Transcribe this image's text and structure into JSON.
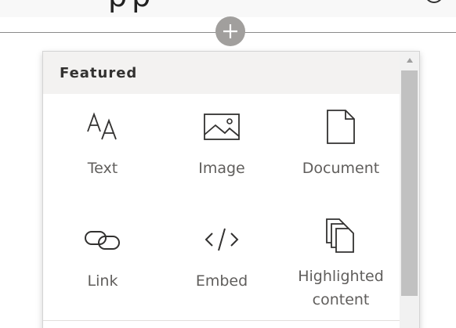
{
  "toolbox": {
    "section_title": "Featured",
    "items": [
      {
        "label": "Text",
        "icon": "text-font-icon"
      },
      {
        "label": "Image",
        "icon": "image-icon"
      },
      {
        "label": "Document",
        "icon": "document-icon"
      },
      {
        "label": "Link",
        "icon": "link-icon"
      },
      {
        "label": "Embed",
        "icon": "embed-code-icon"
      },
      {
        "label": "Highlighted content",
        "icon": "highlighted-content-icon"
      }
    ]
  },
  "colors": {
    "add_button": "#a19f9d",
    "header_bg": "#f3f2f1",
    "label_text": "#605e5c",
    "scroll_thumb": "#c1c1c1"
  }
}
